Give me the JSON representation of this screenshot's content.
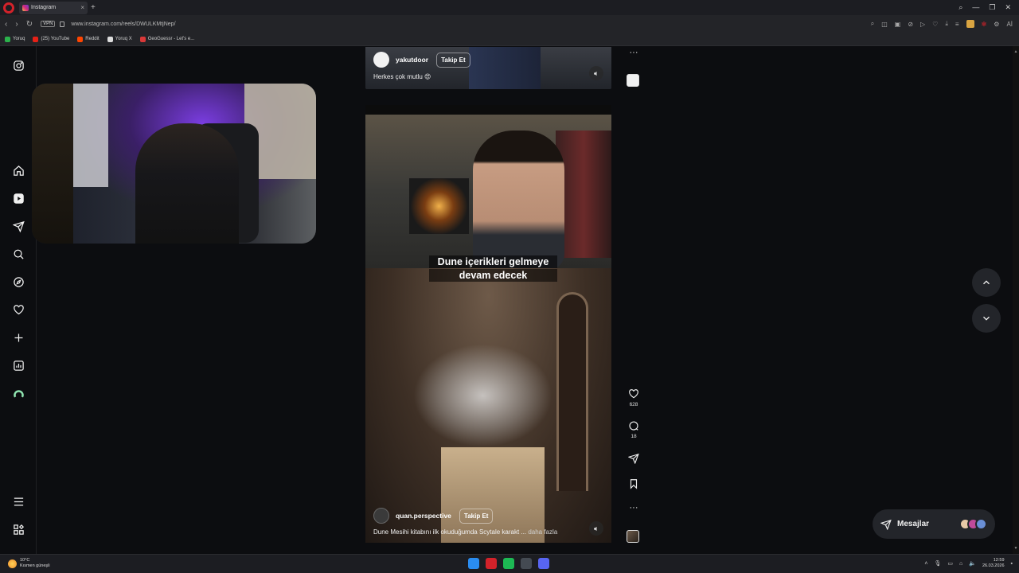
{
  "browser": {
    "tab_title": "Instagram",
    "tab_close": "×",
    "new_tab": "+",
    "url": "www.instagram.com/reels/DWULKMtjNep/",
    "vpn_label": "VPN",
    "window_controls": [
      "—",
      "❐",
      "✕"
    ],
    "ai_label": "Aİ"
  },
  "bookmarks": [
    {
      "label": "Yoruq",
      "color": "#2bb24c"
    },
    {
      "label": "(25) YouTube",
      "color": "#e62117"
    },
    {
      "label": "Reddit",
      "color": "#ff4500"
    },
    {
      "label": "Yoruq X",
      "color": "#dddddd"
    },
    {
      "label": "GeoGuessr - Let's e...",
      "color": "#d93838"
    }
  ],
  "reel_top": {
    "username": "yakutdoor",
    "follow_label": "Takip Et",
    "caption": "Herkes çok mutlu 😍"
  },
  "reel_main": {
    "subtitle_line1": "Dune içerikleri gelmeye",
    "subtitle_line2": "devam edecek",
    "username": "quan.perspective",
    "follow_label": "Takip Et",
    "caption": "Dune Mesihi kitabını ilk okuduğumda Scytale karakt ...",
    "more_label": "daha fazla"
  },
  "actions": {
    "more_top": "···",
    "likes": "628",
    "comments": "18",
    "more_bottom": "···"
  },
  "messages": {
    "label": "Mesajlar",
    "avatar_colors": [
      "#e7c9a6",
      "#c04a9a",
      "#6a8fd6"
    ]
  },
  "taskbar": {
    "temperature": "10°C",
    "weather": "Kısmen güneşli",
    "time": "12:59",
    "date": "26.03.2026",
    "app_colors": [
      "#2a8cf0",
      "#d3222a",
      "#1db954",
      "#444a52",
      "#5865f2"
    ]
  }
}
